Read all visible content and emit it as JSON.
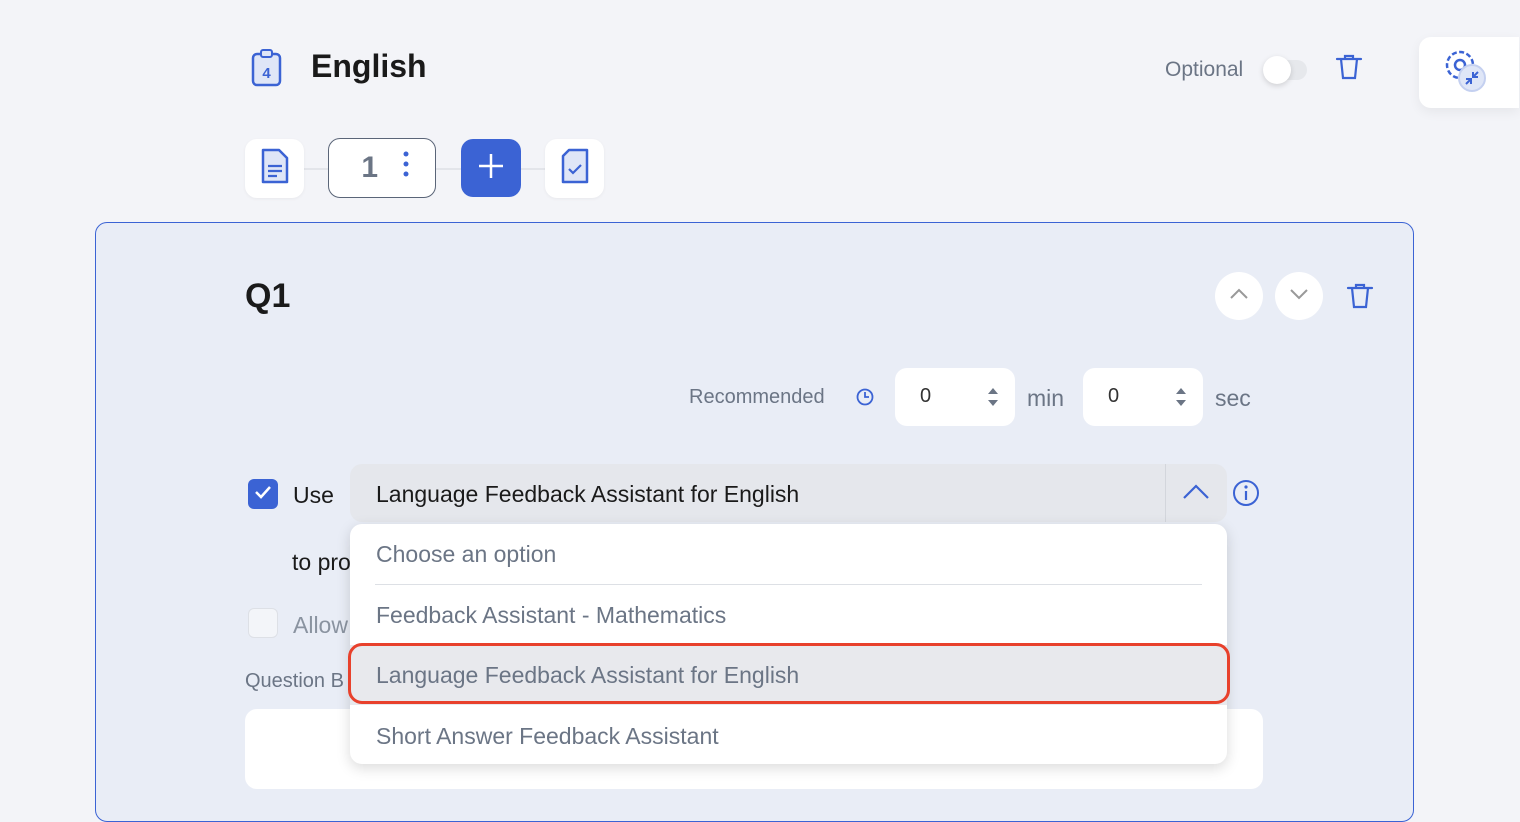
{
  "header": {
    "title": "English",
    "section_badge": "4",
    "optional_label": "Optional",
    "optional_on": false
  },
  "pages": {
    "current": "1"
  },
  "question": {
    "label": "Q1",
    "recommended_label": "Recommended",
    "minutes": "0",
    "min_label": "min",
    "seconds": "0",
    "sec_label": "sec",
    "use_checked": true,
    "use_label": "Use",
    "assistant_selected": "Language Feedback Assistant for English",
    "to_provide_label": "to pro",
    "allow_checked": false,
    "allow_label": "Allow",
    "question_body_label": "Question B"
  },
  "dropdown": {
    "placeholder": "Choose an option",
    "options": [
      "Feedback Assistant - Mathematics",
      "Language Feedback Assistant for English",
      "Short Answer Feedback Assistant"
    ],
    "highlighted": "Language Feedback Assistant for English"
  },
  "colors": {
    "accent": "#3b63d4",
    "highlight_outline": "#e8412c",
    "card_bg": "#e9edf6"
  }
}
